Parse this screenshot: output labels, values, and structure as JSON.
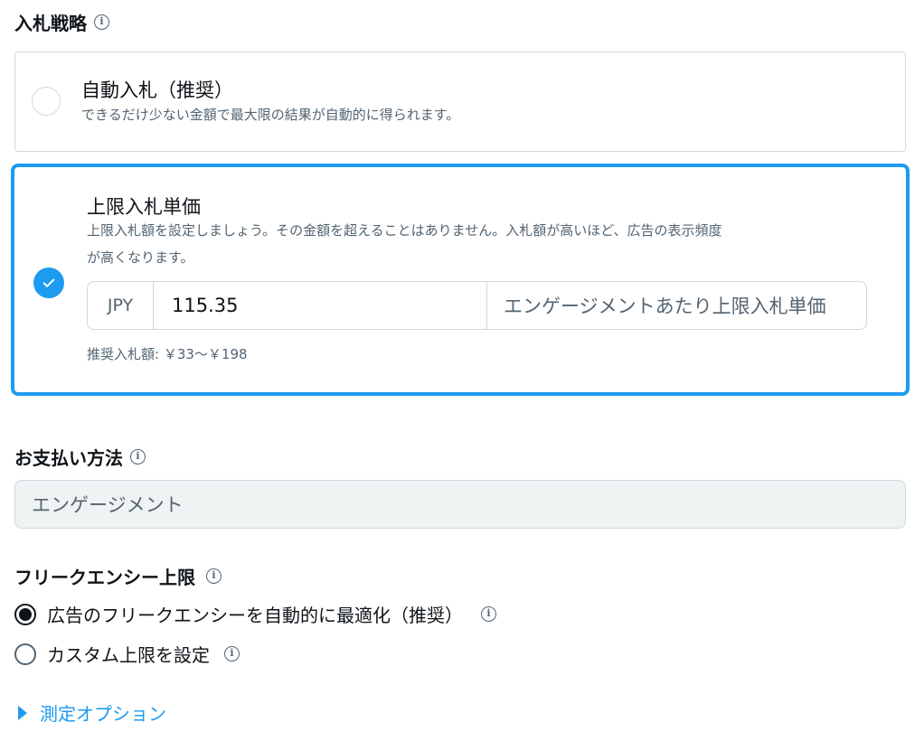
{
  "bid_strategy": {
    "title": "入札戦略",
    "options": [
      {
        "title": "自動入札（推奨）",
        "description": "できるだけ少ない金額で最大限の結果が自動的に得られます。",
        "selected": false
      },
      {
        "title": "上限入札単価",
        "description_line1": "上限入札額を設定しましょう。その金額を超えることはありません。入札額が高いほど、広告の表示頻度",
        "description_line2": "が高くなります。",
        "selected": true,
        "currency": "JPY",
        "amount": "115.35",
        "unit": "エンゲージメントあたり上限入札単価",
        "recommended": "推奨入札額: ￥33～￥198"
      }
    ]
  },
  "payment": {
    "title": "お支払い方法",
    "value": "エンゲージメント"
  },
  "frequency_cap": {
    "title": "フリークエンシー上限",
    "options": [
      {
        "label": "広告のフリークエンシーを自動的に最適化（推奨）",
        "selected": true
      },
      {
        "label": "カスタム上限を設定",
        "selected": false
      }
    ]
  },
  "measurement": {
    "label": "測定オプション"
  },
  "info_glyph": "i",
  "colors": {
    "accent": "#1d9bf0",
    "text": "#0f1419",
    "muted": "#536471",
    "border": "#cfd9de",
    "field_bg": "#eff3f4"
  }
}
